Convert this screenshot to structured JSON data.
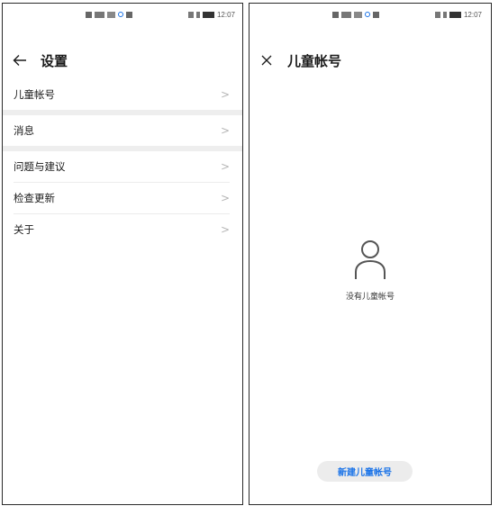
{
  "left": {
    "status": {
      "time": "12:07"
    },
    "header": {
      "title": "设置"
    },
    "items": [
      {
        "label": "儿童帐号",
        "chevron": ">"
      },
      {
        "label": "消息",
        "chevron": ">"
      },
      {
        "label": "问题与建议",
        "chevron": ">"
      },
      {
        "label": "检查更新",
        "chevron": ">"
      },
      {
        "label": "关于",
        "chevron": ">"
      }
    ]
  },
  "right": {
    "status": {
      "time": "12:07"
    },
    "header": {
      "title": "儿童帐号"
    },
    "empty": {
      "text": "没有儿童帐号"
    },
    "button": {
      "label": "新建儿童帐号"
    }
  },
  "colors": {
    "accent": "#1a73e8",
    "separator": "#eeeeee",
    "button_bg": "#ececec"
  },
  "icons": [
    "back-arrow-icon",
    "close-icon",
    "chevron-right-icon",
    "person-icon"
  ]
}
